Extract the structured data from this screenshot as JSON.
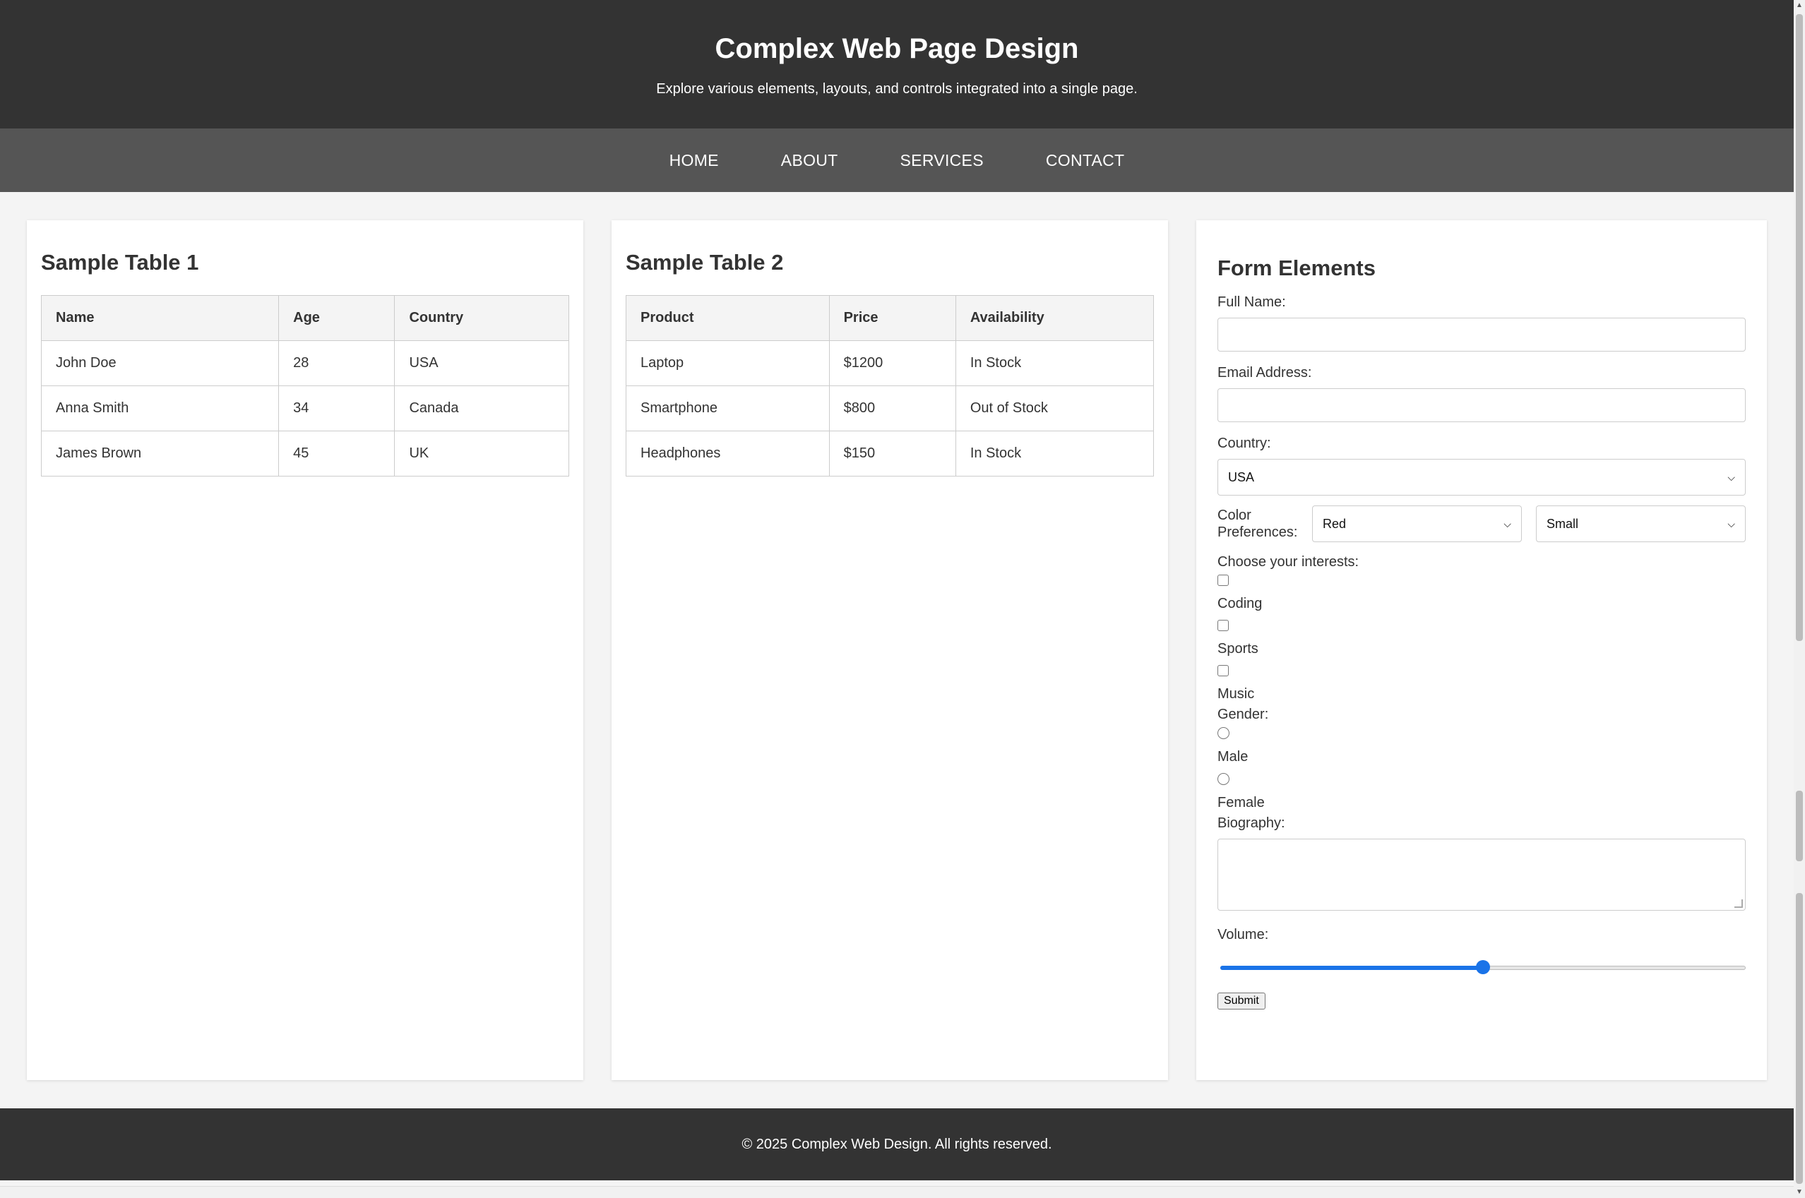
{
  "header": {
    "title": "Complex Web Page Design",
    "subtitle": "Explore various elements, layouts, and controls integrated into a single page."
  },
  "nav": {
    "items": [
      "HOME",
      "ABOUT",
      "SERVICES",
      "CONTACT"
    ]
  },
  "table1": {
    "title": "Sample Table 1",
    "headers": [
      "Name",
      "Age",
      "Country"
    ],
    "rows": [
      [
        "John Doe",
        "28",
        "USA"
      ],
      [
        "Anna Smith",
        "34",
        "Canada"
      ],
      [
        "James Brown",
        "45",
        "UK"
      ]
    ]
  },
  "table2": {
    "title": "Sample Table 2",
    "headers": [
      "Product",
      "Price",
      "Availability"
    ],
    "rows": [
      [
        "Laptop",
        "$1200",
        "In Stock"
      ],
      [
        "Smartphone",
        "$800",
        "Out of Stock"
      ],
      [
        "Headphones",
        "$150",
        "In Stock"
      ]
    ]
  },
  "form": {
    "title": "Form Elements",
    "full_name_label": "Full Name:",
    "full_name_value": "",
    "email_label": "Email Address:",
    "email_value": "",
    "country_label": "Country:",
    "country_value": "USA",
    "color_pref_label": "Color Preferences:",
    "color_value": "Red",
    "size_value": "Small",
    "interests_label": "Choose your interests:",
    "interests": [
      "Coding",
      "Sports",
      "Music"
    ],
    "gender_label": "Gender:",
    "genders": [
      "Male",
      "Female"
    ],
    "bio_label": "Biography:",
    "volume_label": "Volume:",
    "volume_percent": 50,
    "submit_label": "Submit"
  },
  "footer": {
    "text": "© 2025 Complex Web Design. All rights reserved."
  },
  "colors": {
    "header_bg": "#333333",
    "nav_bg": "#555555",
    "accent": "#1a73e8"
  }
}
